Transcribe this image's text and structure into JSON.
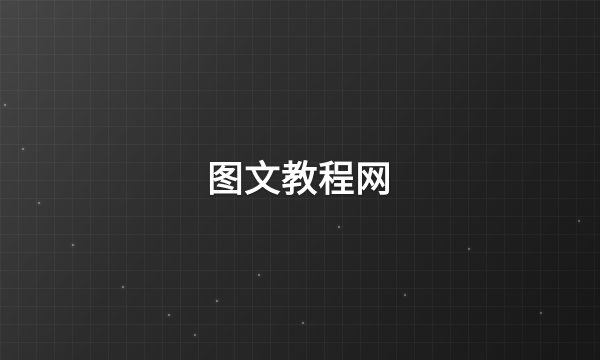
{
  "banner": {
    "title": "图文教程网"
  }
}
